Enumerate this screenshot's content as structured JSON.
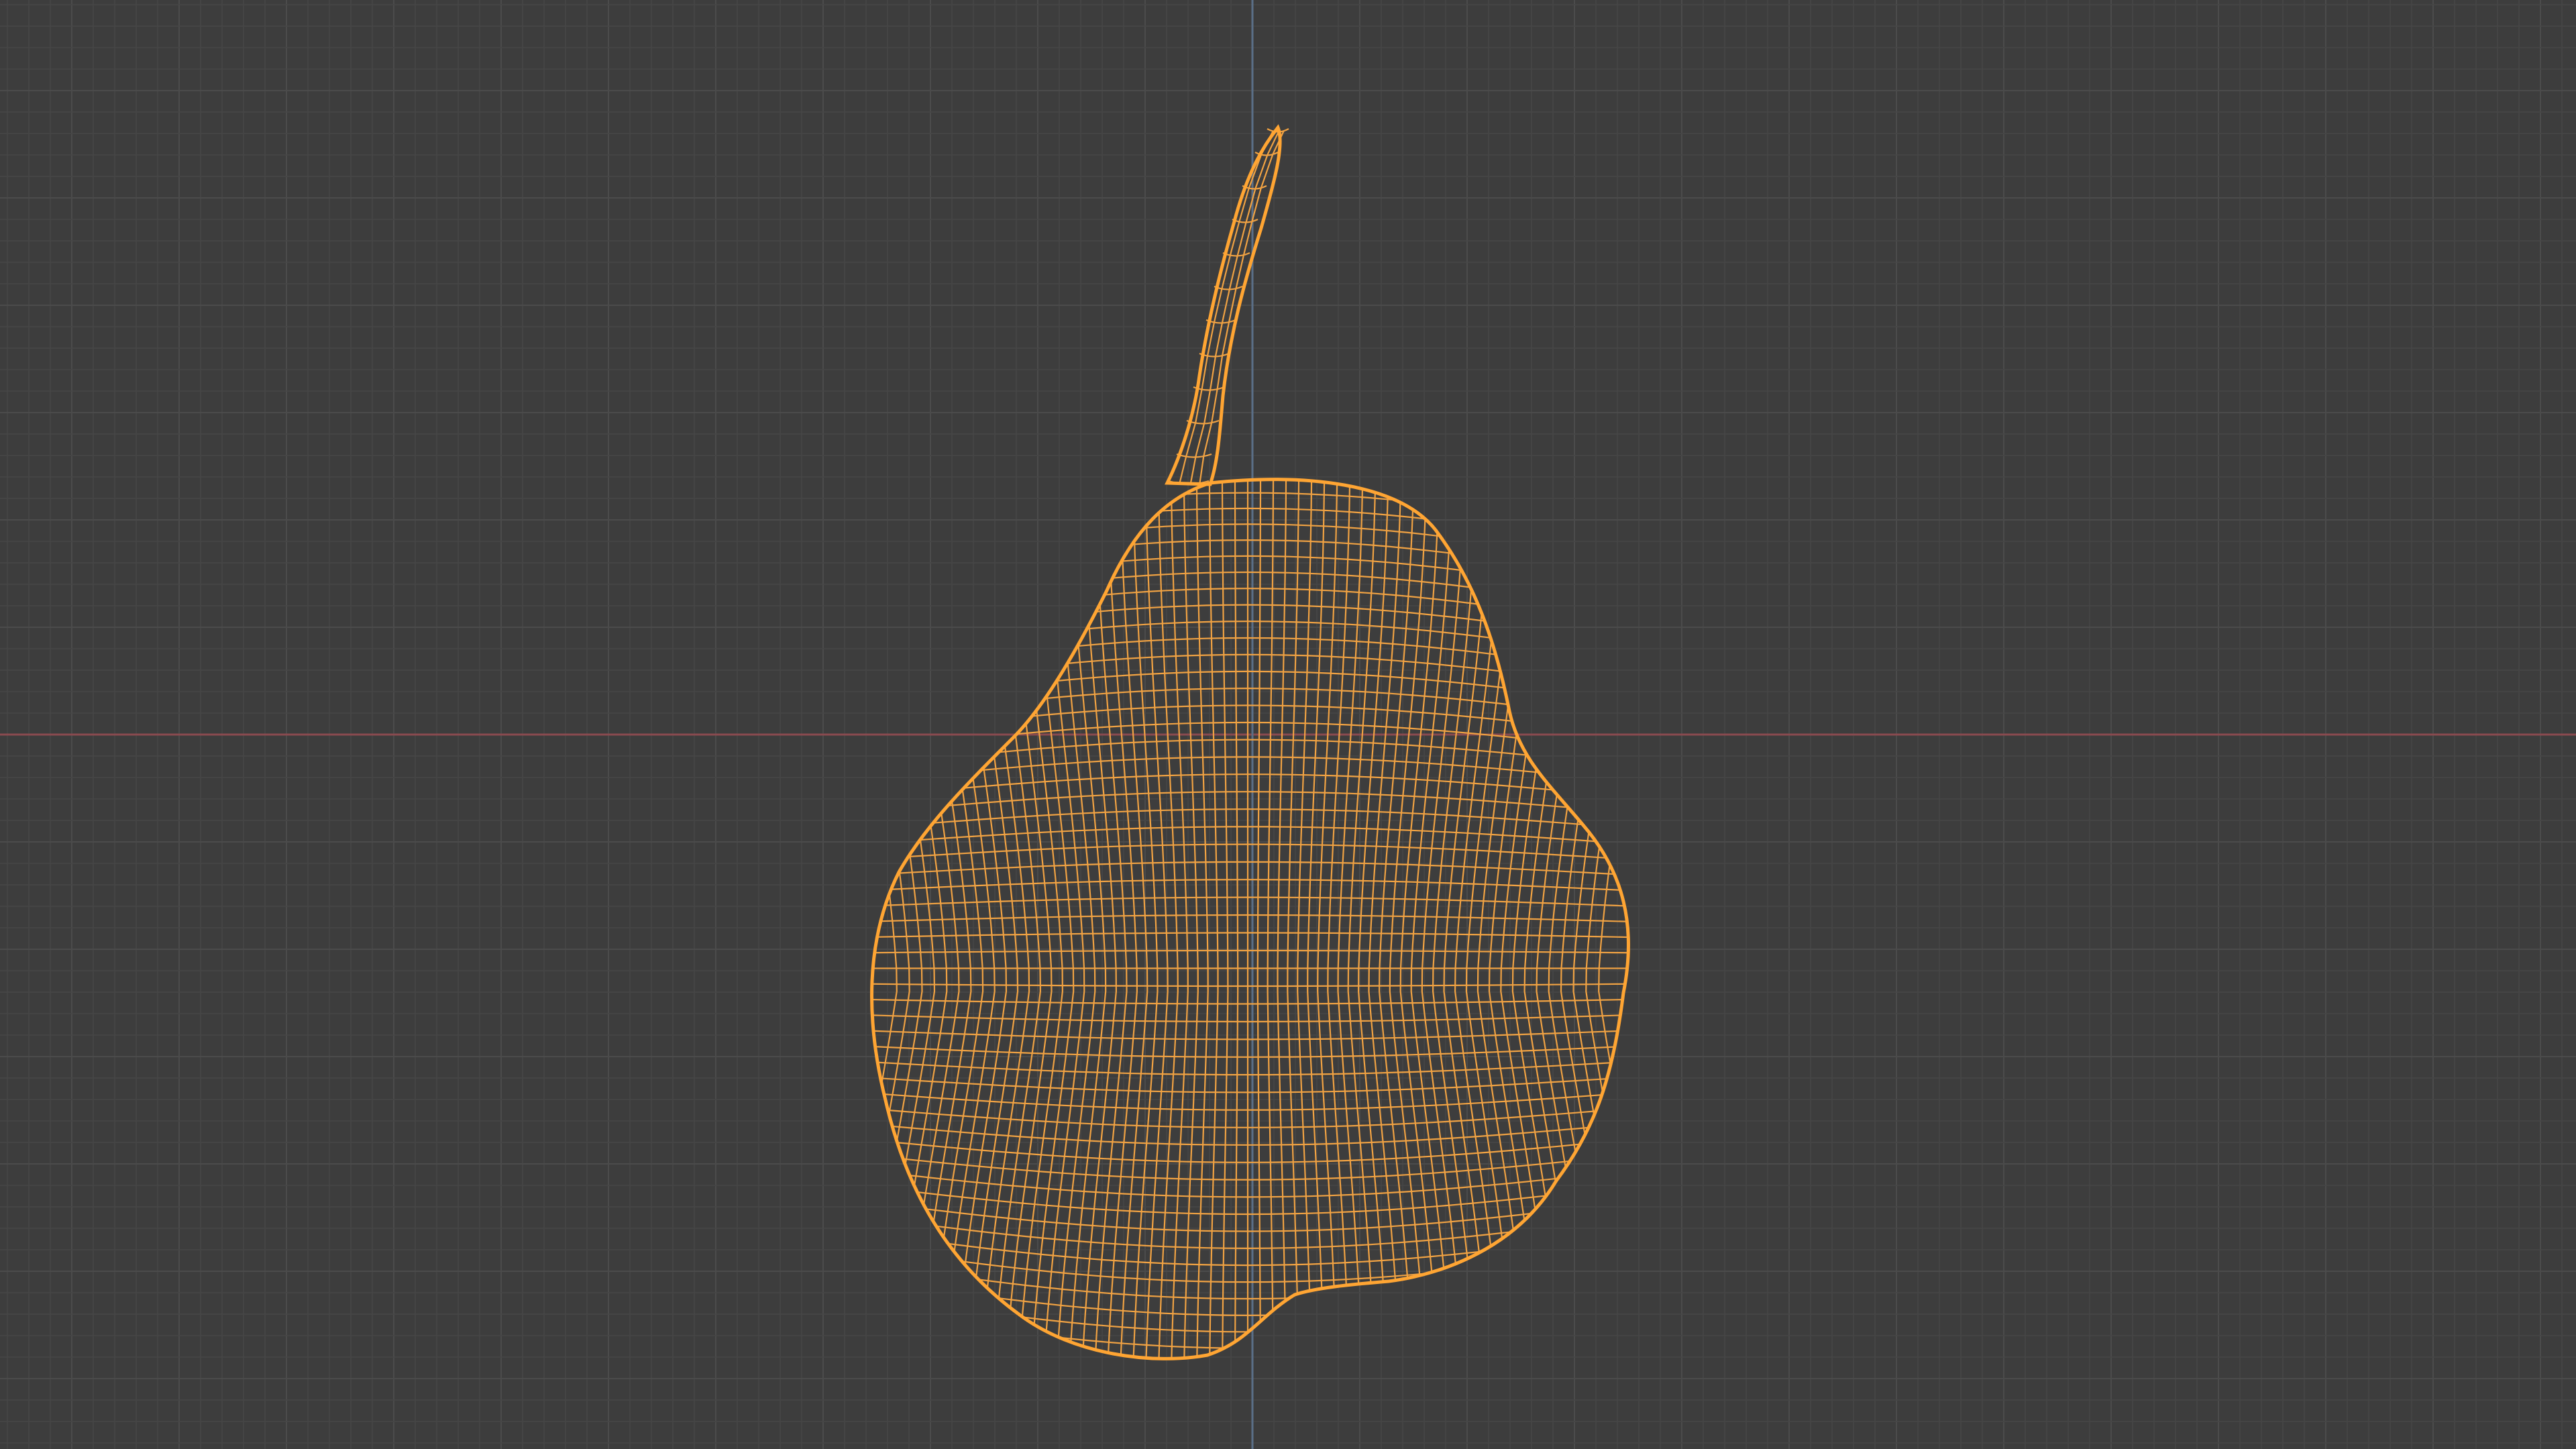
{
  "viewport": {
    "mode": "wireframe",
    "background_color": "#3d3d3d",
    "grid_minor_color": "#464646",
    "grid_major_color": "#4b4b4b",
    "x_axis_color": "#8a4a4f",
    "y_axis_color": "#5a6f87",
    "wire_color": "#f0a243",
    "selection_outline_color": "#ffa533"
  },
  "scene": {
    "objects": [
      {
        "type": "mesh",
        "shape": "pear",
        "selected": true
      }
    ]
  }
}
